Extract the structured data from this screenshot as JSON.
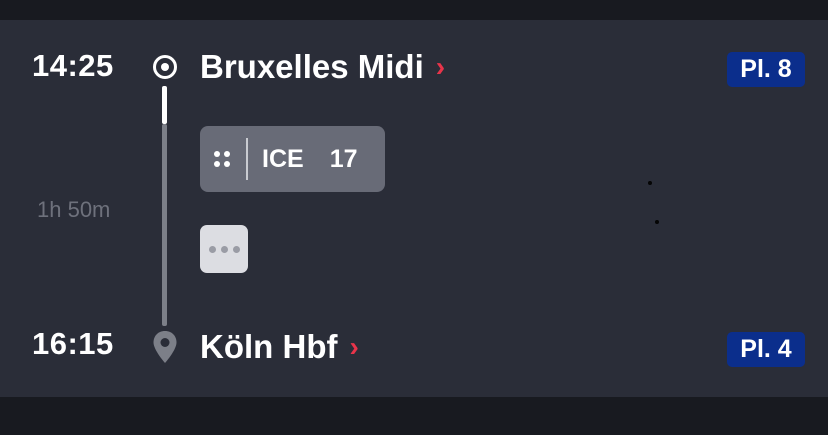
{
  "journey": {
    "departure": {
      "time": "14:25",
      "station": "Bruxelles Midi",
      "platform": "Pl. 8",
      "icon": "origin-target-icon"
    },
    "arrival": {
      "time": "16:15",
      "station": "Köln Hbf",
      "platform": "Pl. 4",
      "icon": "location-pin-icon"
    },
    "duration": "1h 50m",
    "train": {
      "type": "ICE",
      "number": "17",
      "icon": "train-icon"
    },
    "more_icon": "more-horizontal-icon",
    "chevron": "›"
  },
  "colors": {
    "card_background": "#2a2d38",
    "page_background": "#181a20",
    "accent_chevron": "#e8344a",
    "platform_badge": "#0b2e8c",
    "train_badge": "#686b77",
    "duration_text": "#6e717c"
  }
}
